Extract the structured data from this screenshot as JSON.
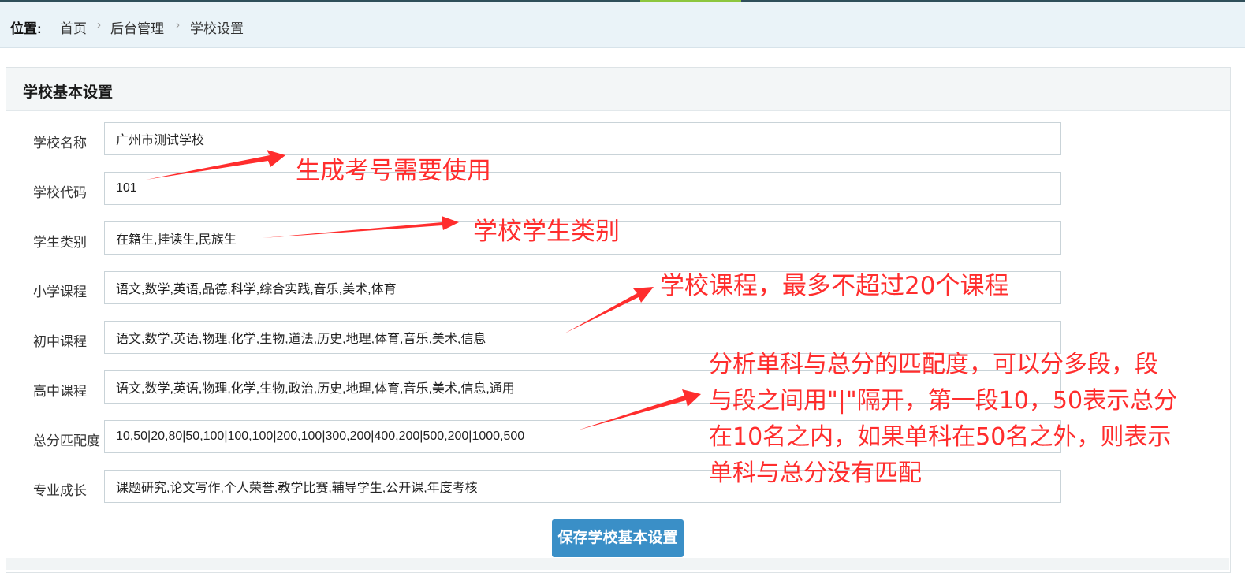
{
  "breadcrumb": {
    "label": "位置:",
    "items": [
      "首页",
      "后台管理",
      "学校设置"
    ],
    "separator": "›"
  },
  "panel": {
    "title": "学校基本设置"
  },
  "form": {
    "rows": [
      {
        "label": "学校名称",
        "value": "广州市测试学校"
      },
      {
        "label": "学校代码",
        "value": "101"
      },
      {
        "label": "学生类别",
        "value": "在籍生,挂读生,民族生"
      },
      {
        "label": "小学课程",
        "value": "语文,数学,英语,品德,科学,综合实践,音乐,美术,体育"
      },
      {
        "label": "初中课程",
        "value": "语文,数学,英语,物理,化学,生物,道法,历史,地理,体育,音乐,美术,信息"
      },
      {
        "label": "高中课程",
        "value": "语文,数学,英语,物理,化学,生物,政治,历史,地理,体育,音乐,美术,信息,通用"
      },
      {
        "label": "总分匹配度",
        "value": "10,50|20,80|50,100|100,100|200,100|300,200|400,200|500,200|1000,500"
      },
      {
        "label": "专业成长",
        "value": "课题研究,论文写作,个人荣誉,教学比赛,辅导学生,公开课,年度考核"
      }
    ],
    "save_label": "保存学校基本设置"
  },
  "annotations": {
    "code_note": "生成考号需要使用",
    "category_note": "学校学生类别",
    "course_note": "学校课程，最多不超过20个课程",
    "match_note_lines": [
      "分析单科与总分的匹配度，可以分多段，段",
      "与段之间用\"|\"隔开，第一段10，50表示总分",
      "在10名之内，如果单科在50名之外，则表示",
      "单科与总分没有匹配"
    ]
  },
  "colors": {
    "annotation": "#ff2d2d",
    "button": "#3a8fc7",
    "breadcrumb_bg": "#eaf3f8"
  }
}
